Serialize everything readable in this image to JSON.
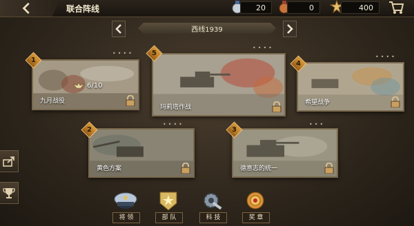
{
  "header": {
    "title": "联合阵线"
  },
  "resources": [
    {
      "name": "silver-medal-icon",
      "value": "20",
      "color": "#c8d0d8"
    },
    {
      "name": "bronze-medal-icon",
      "value": "0",
      "color": "#c8743a"
    },
    {
      "name": "star-badge-icon",
      "value": "400",
      "color": "#e6c070"
    }
  ],
  "chapter": {
    "title": "西线1939"
  },
  "missions": [
    {
      "number": "1",
      "name": "九月战役",
      "progress": "6/10",
      "locked": true
    },
    {
      "number": "5",
      "name": "玛莉塔作战",
      "locked": true
    },
    {
      "number": "4",
      "name": "希望战争",
      "locked": true
    },
    {
      "number": "2",
      "name": "黄色方案",
      "locked": true
    },
    {
      "number": "3",
      "name": "德意志的统一",
      "locked": true
    }
  ],
  "bottom_nav": [
    {
      "label": "将 领",
      "icon": "general-cap-icon"
    },
    {
      "label": "部 队",
      "icon": "army-badge-icon"
    },
    {
      "label": "科 技",
      "icon": "gear-wrench-icon"
    },
    {
      "label": "奖 章",
      "icon": "medal-icon"
    }
  ]
}
